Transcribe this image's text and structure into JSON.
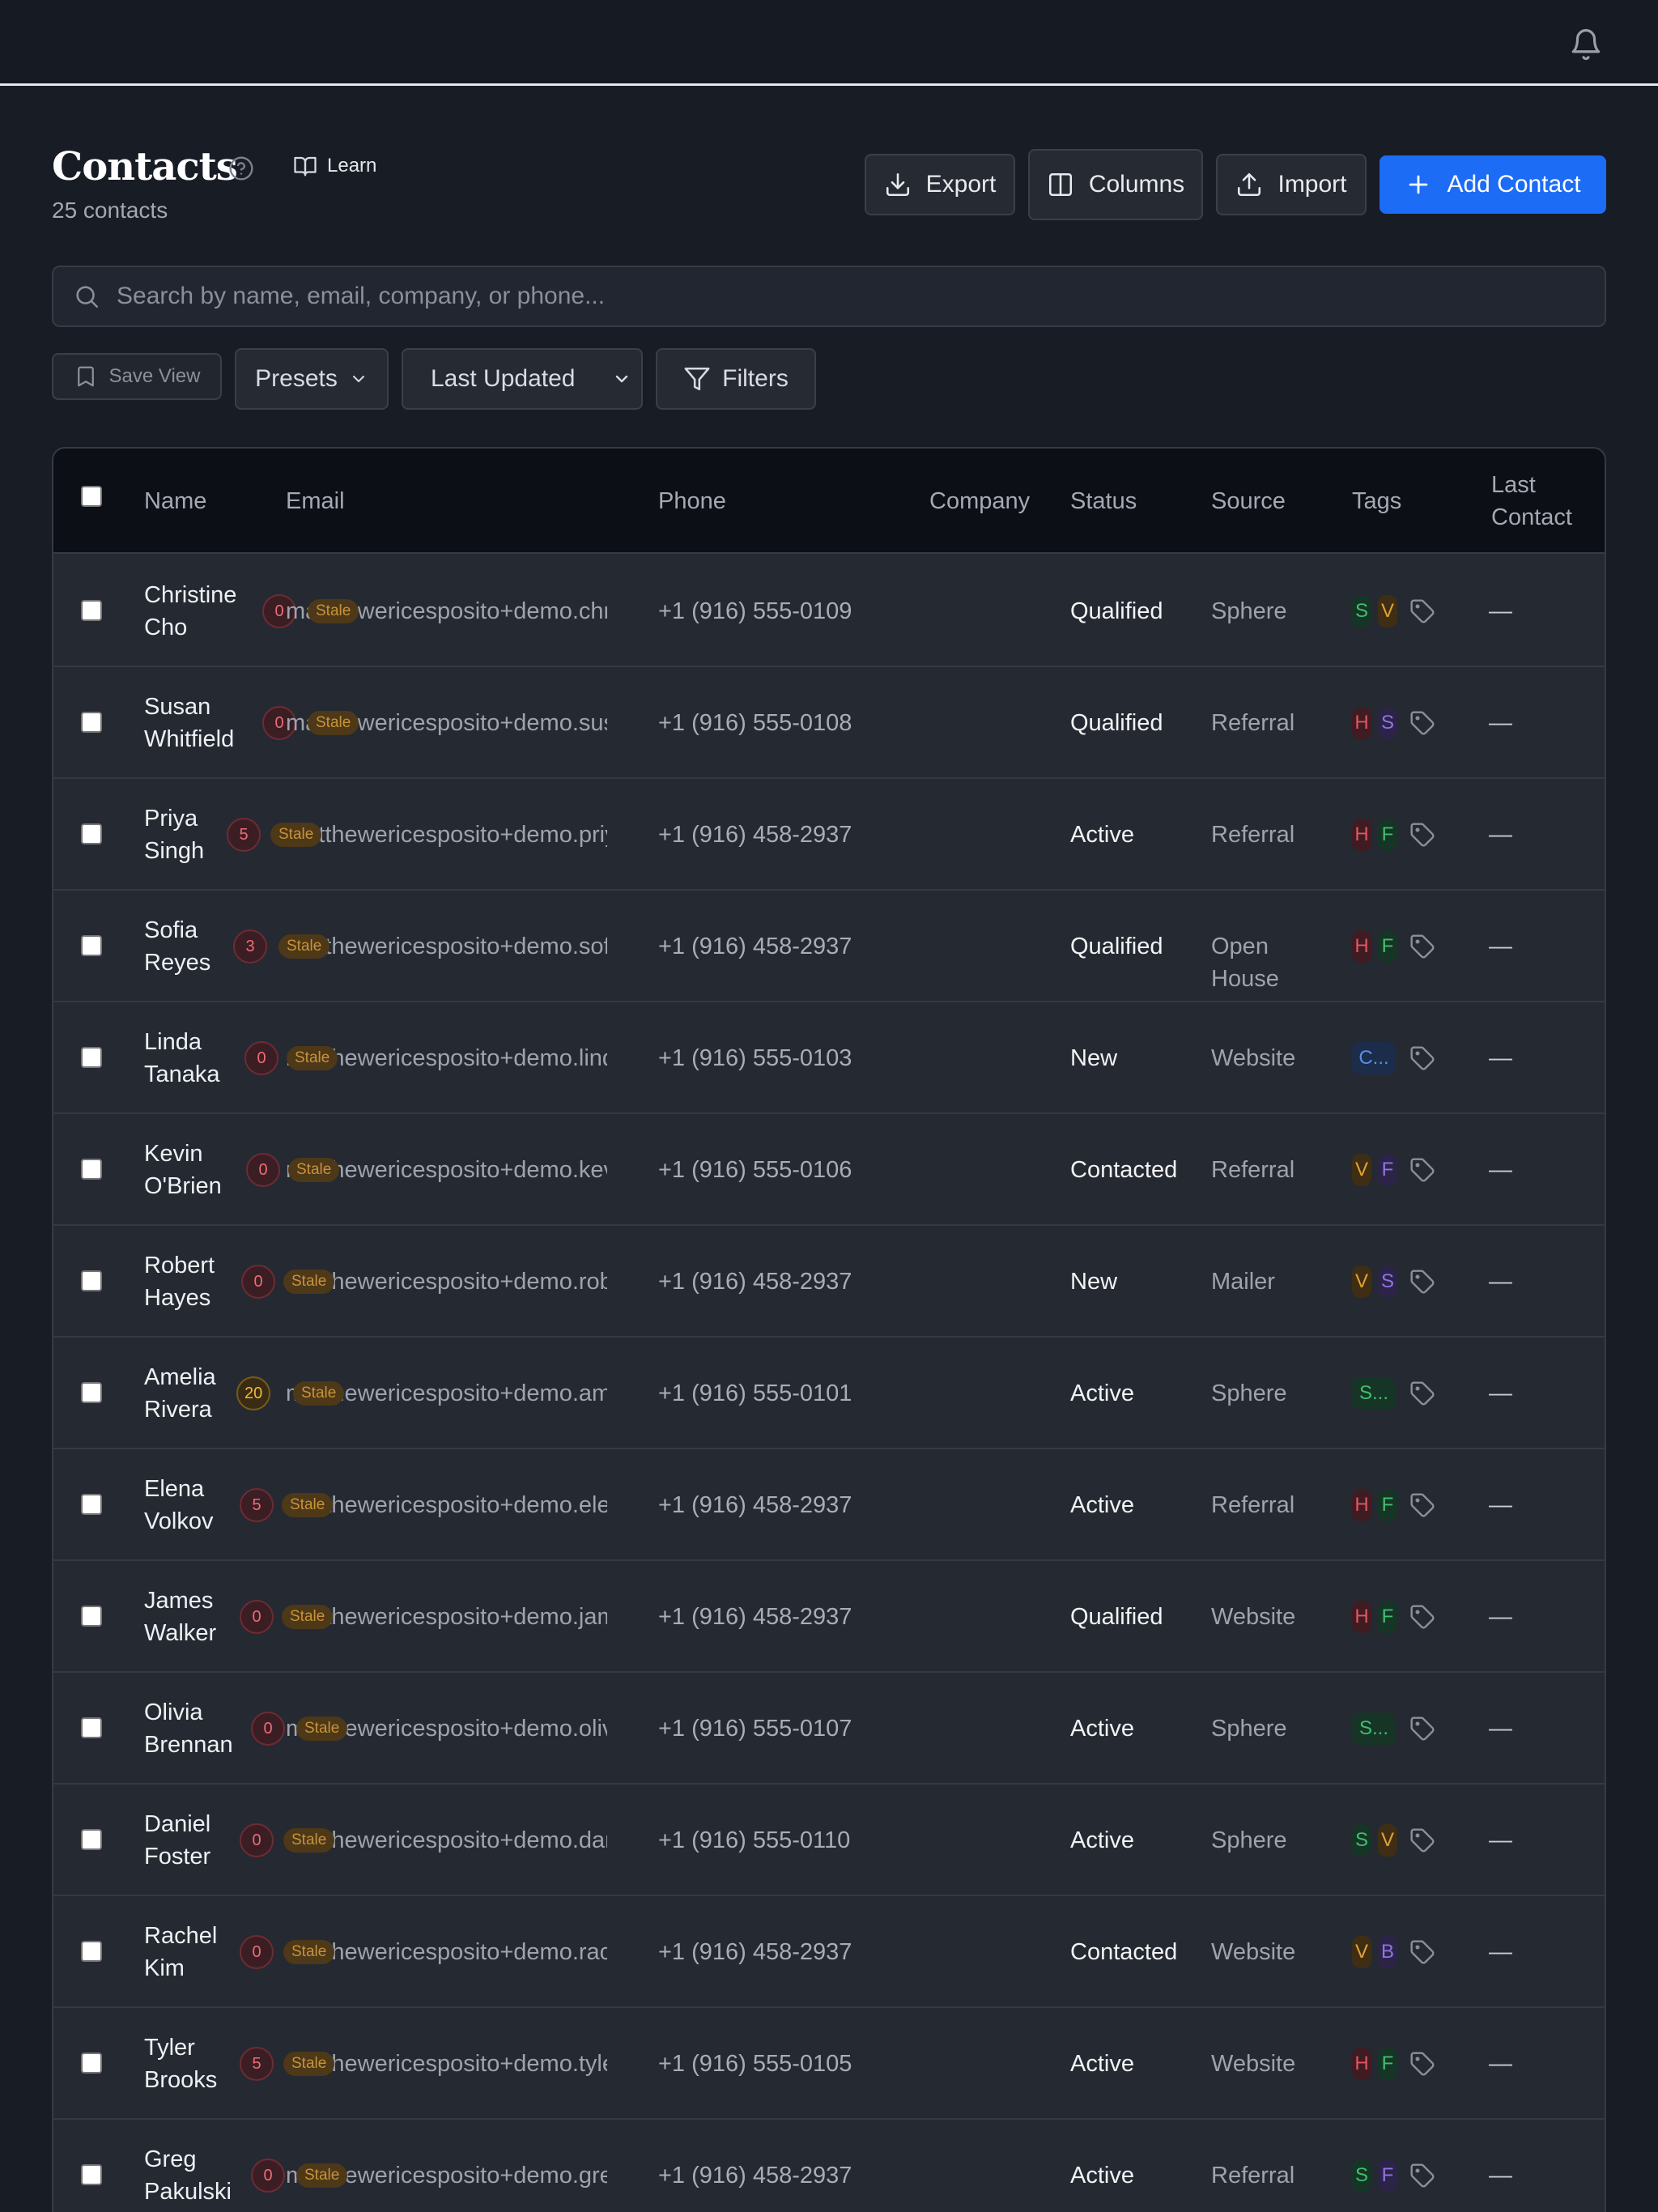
{
  "header": {
    "title": "Contacts",
    "subtitle": "25 contacts",
    "learn_label": "Learn"
  },
  "toolbar": {
    "export_label": "Export",
    "columns_label": "Columns",
    "import_label": "Import",
    "add_label": "Add Contact"
  },
  "search": {
    "placeholder": "Search by name, email, company, or phone..."
  },
  "filters": {
    "save_view_label": "Save View",
    "presets_label": "Presets",
    "sort_value": "Last Updated",
    "filters_label": "Filters"
  },
  "table": {
    "columns": {
      "name": "Name",
      "email": "Email",
      "phone": "Phone",
      "company": "Company",
      "status": "Status",
      "source": "Source",
      "tags": "Tags",
      "last_contact": "Last Contact"
    },
    "rows": [
      {
        "name": "Christine Cho",
        "score": "0",
        "score_color": "red",
        "stale": "Stale",
        "email": "matthewericesposito+demo.christine",
        "phone": "+1 (916) 555-0109",
        "status": "Qualified",
        "source": "Sphere",
        "tags": [
          {
            "text": "S",
            "color": "green"
          },
          {
            "text": "V",
            "color": "amber"
          }
        ],
        "last_contact": "—"
      },
      {
        "name": "Susan Whitfield",
        "score": "0",
        "score_color": "red",
        "stale": "Stale",
        "email": "matthewericesposito+demo.susan",
        "phone": "+1 (916) 555-0108",
        "status": "Qualified",
        "source": "Referral",
        "tags": [
          {
            "text": "H",
            "color": "red"
          },
          {
            "text": "S",
            "color": "purple"
          }
        ],
        "last_contact": "—"
      },
      {
        "name": "Priya Singh",
        "score": "5",
        "score_color": "red",
        "stale": "Stale",
        "email": "matthewericesposito+demo.priya",
        "phone": "+1 (916) 458-2937",
        "status": "Active",
        "source": "Referral",
        "tags": [
          {
            "text": "H",
            "color": "red"
          },
          {
            "text": "F",
            "color": "green"
          }
        ],
        "last_contact": "—"
      },
      {
        "name": "Sofia Reyes",
        "score": "3",
        "score_color": "red",
        "stale": "Stale",
        "email": "matthewericesposito+demo.sofia",
        "phone": "+1 (916) 458-2937",
        "status": "Qualified",
        "source": "Open House",
        "tags": [
          {
            "text": "H",
            "color": "red"
          },
          {
            "text": "F",
            "color": "green"
          }
        ],
        "last_contact": "—"
      },
      {
        "name": "Linda Tanaka",
        "score": "0",
        "score_color": "red",
        "stale": "Stale",
        "email": "matthewericesposito+demo.linda",
        "phone": "+1 (916) 555-0103",
        "status": "New",
        "source": "Website",
        "tags": [
          {
            "text": "C...",
            "color": "blue"
          }
        ],
        "last_contact": "—"
      },
      {
        "name": "Kevin O'Brien",
        "score": "0",
        "score_color": "red",
        "stale": "Stale",
        "email": "matthewericesposito+demo.kevin",
        "phone": "+1 (916) 555-0106",
        "status": "Contacted",
        "source": "Referral",
        "tags": [
          {
            "text": "V",
            "color": "amber"
          },
          {
            "text": "F",
            "color": "purple"
          }
        ],
        "last_contact": "—"
      },
      {
        "name": "Robert Hayes",
        "score": "0",
        "score_color": "red",
        "stale": "Stale",
        "email": "matthewericesposito+demo.robert",
        "phone": "+1 (916) 458-2937",
        "status": "New",
        "source": "Mailer",
        "tags": [
          {
            "text": "V",
            "color": "amber"
          },
          {
            "text": "S",
            "color": "purple"
          }
        ],
        "last_contact": "—"
      },
      {
        "name": "Amelia Rivera",
        "score": "20",
        "score_color": "amber",
        "stale": "Stale",
        "email": "matthewericesposito+demo.amelia",
        "phone": "+1 (916) 555-0101",
        "status": "Active",
        "source": "Sphere",
        "tags": [
          {
            "text": "S...",
            "color": "green"
          }
        ],
        "last_contact": "—"
      },
      {
        "name": "Elena Volkov",
        "score": "5",
        "score_color": "red",
        "stale": "Stale",
        "email": "matthewericesposito+demo.elena",
        "phone": "+1 (916) 458-2937",
        "status": "Active",
        "source": "Referral",
        "tags": [
          {
            "text": "H",
            "color": "red"
          },
          {
            "text": "F",
            "color": "green"
          }
        ],
        "last_contact": "—"
      },
      {
        "name": "James Walker",
        "score": "0",
        "score_color": "red",
        "stale": "Stale",
        "email": "matthewericesposito+demo.james",
        "phone": "+1 (916) 458-2937",
        "status": "Qualified",
        "source": "Website",
        "tags": [
          {
            "text": "H",
            "color": "red"
          },
          {
            "text": "F",
            "color": "green"
          }
        ],
        "last_contact": "—"
      },
      {
        "name": "Olivia Brennan",
        "score": "0",
        "score_color": "red",
        "stale": "Stale",
        "email": "matthewericesposito+demo.olivia",
        "phone": "+1 (916) 555-0107",
        "status": "Active",
        "source": "Sphere",
        "tags": [
          {
            "text": "S...",
            "color": "green"
          }
        ],
        "last_contact": "—"
      },
      {
        "name": "Daniel Foster",
        "score": "0",
        "score_color": "red",
        "stale": "Stale",
        "email": "matthewericesposito+demo.daniel",
        "phone": "+1 (916) 555-0110",
        "status": "Active",
        "source": "Sphere",
        "tags": [
          {
            "text": "S",
            "color": "green"
          },
          {
            "text": "V",
            "color": "amber"
          }
        ],
        "last_contact": "—"
      },
      {
        "name": "Rachel Kim",
        "score": "0",
        "score_color": "red",
        "stale": "Stale",
        "email": "matthewericesposito+demo.rachel",
        "phone": "+1 (916) 458-2937",
        "status": "Contacted",
        "source": "Website",
        "tags": [
          {
            "text": "V",
            "color": "amber"
          },
          {
            "text": "B",
            "color": "purple"
          }
        ],
        "last_contact": "—"
      },
      {
        "name": "Tyler Brooks",
        "score": "5",
        "score_color": "red",
        "stale": "Stale",
        "email": "matthewericesposito+demo.tyler",
        "phone": "+1 (916) 555-0105",
        "status": "Active",
        "source": "Website",
        "tags": [
          {
            "text": "H",
            "color": "red"
          },
          {
            "text": "F",
            "color": "green"
          }
        ],
        "last_contact": "—"
      },
      {
        "name": "Greg Pakulski",
        "score": "0",
        "score_color": "red",
        "stale": "Stale",
        "email": "matthewericesposito+demo.greg",
        "phone": "+1 (916) 458-2937",
        "status": "Active",
        "source": "Referral",
        "tags": [
          {
            "text": "S",
            "color": "green"
          },
          {
            "text": "F",
            "color": "purple"
          }
        ],
        "last_contact": "—"
      }
    ]
  }
}
